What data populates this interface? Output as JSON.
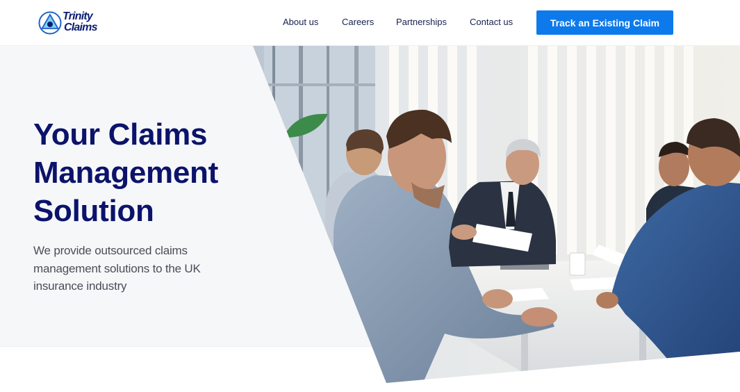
{
  "header": {
    "logo": {
      "line1": "Trinity",
      "line2": "Claims"
    },
    "nav": [
      {
        "label": "About us"
      },
      {
        "label": "Careers"
      },
      {
        "label": "Partnerships"
      },
      {
        "label": "Contact us"
      }
    ],
    "cta_label": "Track an Existing Claim"
  },
  "hero": {
    "title_lines": [
      "Your Claims",
      "Management",
      "Solution"
    ],
    "subtitle": "We provide outsourced claims management solutions to the UK insurance industry",
    "image": "business-meeting-photo"
  },
  "colors": {
    "brand_navy": "#0b136a",
    "accent_blue": "#0d7aec",
    "hero_background": "#f6f7f9",
    "body_text": "#4a4d57",
    "white": "#ffffff"
  }
}
